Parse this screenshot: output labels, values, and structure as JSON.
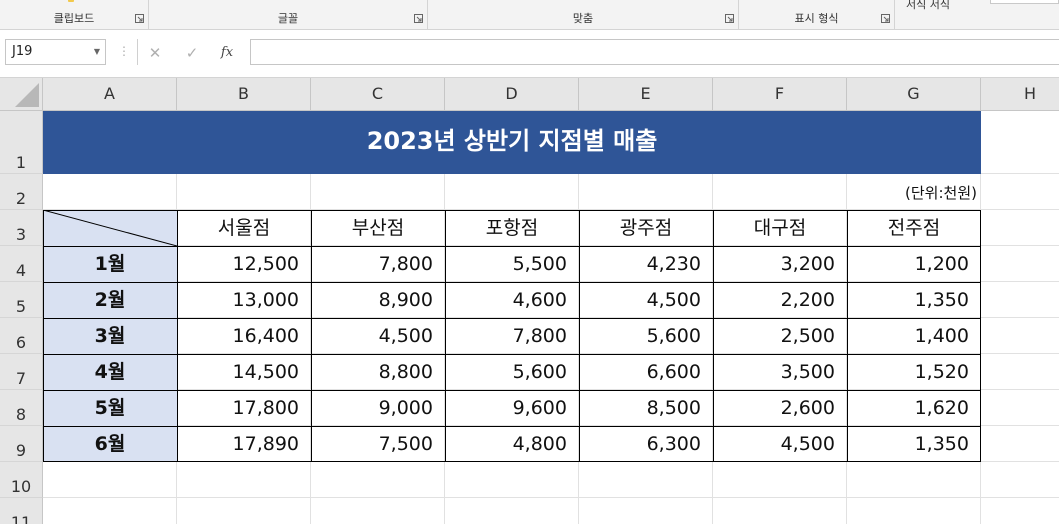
{
  "ribbon": {
    "groups": [
      {
        "label": "클립보드"
      },
      {
        "label": "글꼴"
      },
      {
        "label": "맞춤"
      },
      {
        "label": "표시 형식"
      }
    ],
    "partial_right": "서식   서식"
  },
  "formula_bar": {
    "name_box": "J19",
    "cancel": "✕",
    "enter": "✓",
    "fx": "fx",
    "value": ""
  },
  "columns": [
    "A",
    "B",
    "C",
    "D",
    "E",
    "F",
    "G",
    "H"
  ],
  "rows": [
    "1",
    "2",
    "3",
    "4",
    "5",
    "6",
    "7",
    "8",
    "9",
    "10",
    "11"
  ],
  "sheet": {
    "title": "2023년 상반기 지점별 매출",
    "unit": "(단위:천원)",
    "branches": [
      "서울점",
      "부산점",
      "포항점",
      "광주점",
      "대구점",
      "전주점"
    ],
    "months": [
      "1월",
      "2월",
      "3월",
      "4월",
      "5월",
      "6월"
    ],
    "values": [
      [
        "12,500",
        "7,800",
        "5,500",
        "4,230",
        "3,200",
        "1,200"
      ],
      [
        "13,000",
        "8,900",
        "4,600",
        "4,500",
        "2,200",
        "1,350"
      ],
      [
        "16,400",
        "4,500",
        "7,800",
        "5,600",
        "2,500",
        "1,400"
      ],
      [
        "14,500",
        "8,800",
        "5,600",
        "6,600",
        "3,500",
        "1,520"
      ],
      [
        "17,800",
        "9,000",
        "9,600",
        "8,500",
        "2,600",
        "1,620"
      ],
      [
        "17,890",
        "7,500",
        "4,800",
        "6,300",
        "4,500",
        "1,350"
      ]
    ]
  },
  "colors": {
    "title_fill": "#2f5597",
    "month_fill": "#d9e1f2",
    "header_fill": "#e6e6e6"
  }
}
